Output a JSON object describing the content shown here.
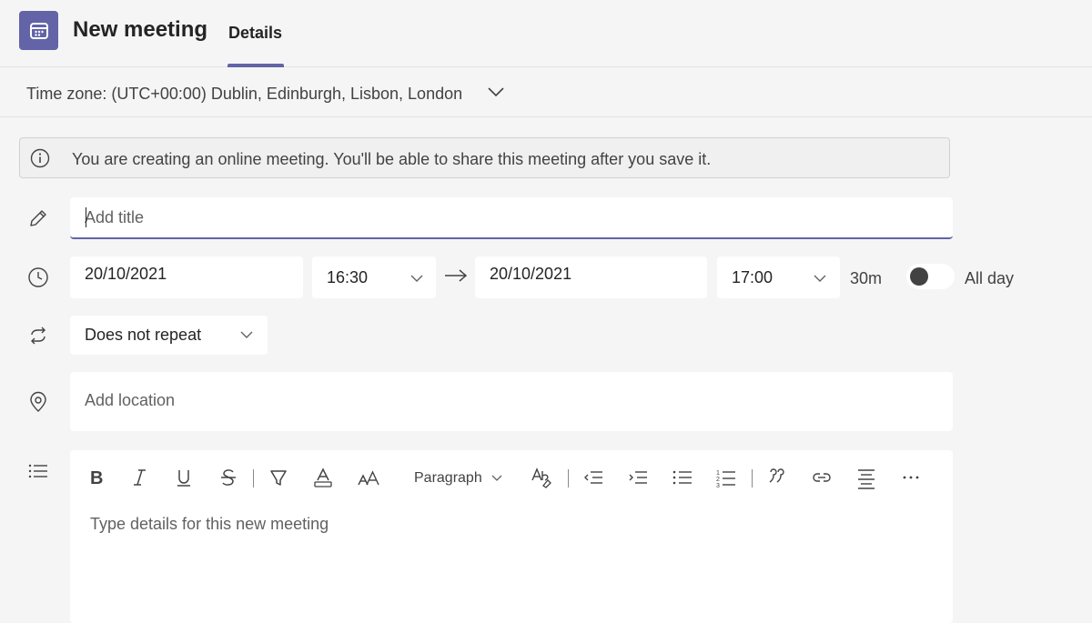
{
  "header": {
    "title": "New meeting",
    "tabs": [
      {
        "label": "Details",
        "active": true
      }
    ],
    "accent": "#6264a7"
  },
  "timezone": {
    "label": "Time zone: (UTC+00:00) Dublin, Edinburgh, Lisbon, London"
  },
  "banner": {
    "text": "You are creating an online meeting. You'll be able to share this meeting after you save it."
  },
  "title_field": {
    "placeholder": "Add title",
    "value": ""
  },
  "schedule": {
    "start_date": "20/10/2021",
    "start_time": "16:30",
    "end_date": "20/10/2021",
    "end_time": "17:00",
    "duration": "30m",
    "all_day_label": "All day",
    "all_day_on": false
  },
  "repeat": {
    "selected": "Does not repeat"
  },
  "location": {
    "placeholder": "Add location"
  },
  "editor": {
    "paragraph_label": "Paragraph",
    "placeholder": "Type details for this new meeting"
  },
  "icons": [
    "calendar-icon",
    "chevron-down-icon",
    "info-icon",
    "pencil-icon",
    "clock-icon",
    "arrow-right-icon",
    "repeat-icon",
    "location-pin-icon",
    "details-list-icon",
    "bold-icon",
    "italic-icon",
    "underline-icon",
    "strikethrough-icon",
    "highlight-icon",
    "font-color-icon",
    "font-size-icon",
    "format-painter-icon",
    "decrease-indent-icon",
    "increase-indent-icon",
    "bulleted-list-icon",
    "numbered-list-icon",
    "quote-icon",
    "link-icon",
    "align-center-icon",
    "more-icon"
  ]
}
